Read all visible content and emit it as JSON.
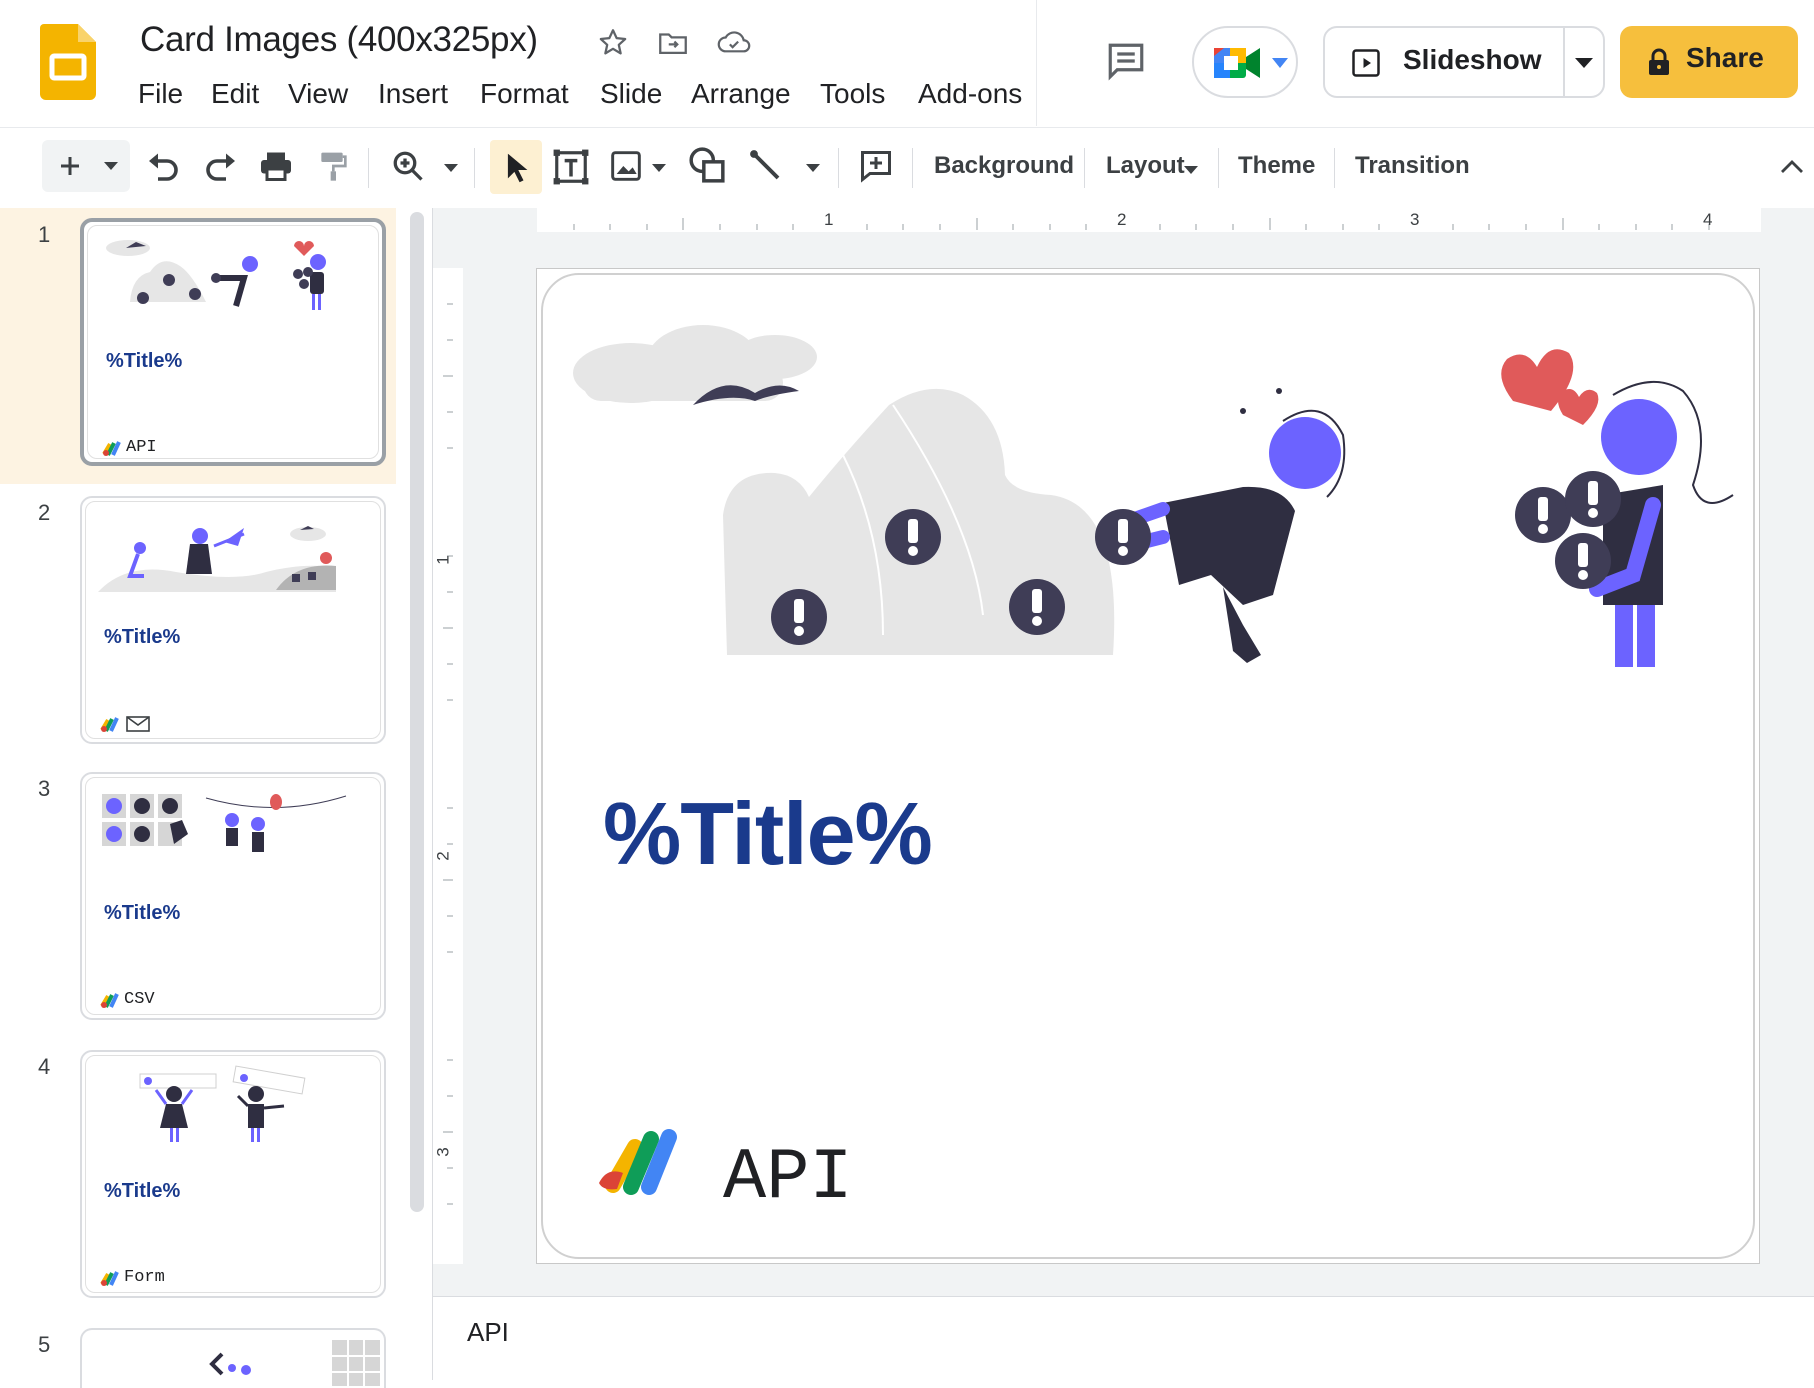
{
  "header": {
    "doc_title": "Card Images (400x325px)",
    "menu": [
      "File",
      "Edit",
      "View",
      "Insert",
      "Format",
      "Slide",
      "Arrange",
      "Tools",
      "Add-ons"
    ],
    "slideshow_label": "Slideshow",
    "share_label": "Share"
  },
  "toolbar": {
    "background_label": "Background",
    "layout_label": "Layout",
    "theme_label": "Theme",
    "transition_label": "Transition"
  },
  "filmstrip": {
    "slides": [
      {
        "num": "1",
        "title": "%Title%",
        "footer": "API"
      },
      {
        "num": "2",
        "title": "%Title%",
        "footer": ""
      },
      {
        "num": "3",
        "title": "%Title%",
        "footer": "CSV"
      },
      {
        "num": "4",
        "title": "%Title%",
        "footer": "Form"
      },
      {
        "num": "5",
        "title": "",
        "footer": ""
      }
    ]
  },
  "ruler": {
    "h_labels": [
      "1",
      "2",
      "3",
      "4"
    ],
    "v_labels": [
      "1",
      "2",
      "3"
    ]
  },
  "slide": {
    "title": "%Title%",
    "footer": "API"
  },
  "notes": {
    "text": "API"
  },
  "colors": {
    "accent_purple": "#6c63ff",
    "title_blue": "#1a3a8c",
    "share_yellow": "#f6bf3d",
    "dark_figure": "#2f2e41",
    "heart_red": "#e05a5a"
  }
}
